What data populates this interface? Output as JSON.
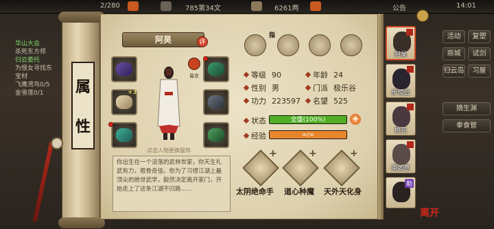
{
  "topbar": {
    "counter": "2/280",
    "rank": "785第34文",
    "money": "6261两",
    "notice": "公告",
    "time": "14:01"
  },
  "quests": [
    {
      "title": "华山大会",
      "text": "杀死东方师"
    },
    {
      "title": "归云委托",
      "text": "为恨女寻找东"
    },
    {
      "title": "",
      "text": "宝材"
    },
    {
      "title": "",
      "text": "飞鹰鸢鸟0/5"
    },
    {
      "title": "",
      "text": "金雪莲0/1"
    }
  ],
  "right_menu": [
    "活动",
    "复塑",
    "商城",
    "试剑",
    "归云岛",
    "习屋",
    "摘生渊",
    "拳食管"
  ],
  "scroll": {
    "title_top": "属",
    "title_bottom": "性"
  },
  "character": {
    "name": "阿昊",
    "badge": "评",
    "swap_label": "易衣",
    "change_hint": "点击人物更换服饰",
    "equip_plus": "+3"
  },
  "icons": {
    "zhi_label": "指"
  },
  "stats": {
    "level_label": "等级",
    "level": "90",
    "age_label": "年龄",
    "age": "24",
    "gender_label": "性别",
    "gender": "男",
    "sect_label": "门派",
    "sect": "极乐谷",
    "power_label": "功力",
    "power": "223597",
    "fame_label": "名望",
    "fame": "525",
    "state_label": "状态",
    "state_text": "全盛(100%)",
    "state_fill": 1.0,
    "exp_label": "经验",
    "exp_text": "∞/∞",
    "exp_fill": 1.0
  },
  "description": "你出生在一个没落的武林世家，你天生礼武有力，根骨奇佳。你为了习得江湖上最顶尖的绝世武学，毅然决定离开家门，开始走上了这条江湖不归路……",
  "skills": [
    {
      "name": "太阴绝命手",
      "plus": "+"
    },
    {
      "name": "道心种魔",
      "plus": "+"
    },
    {
      "name": "天外天化身",
      "plus": "+"
    }
  ],
  "party": [
    {
      "name": "阿昊",
      "tag": "战"
    },
    {
      "name": "步惊云",
      "tag": "战"
    },
    {
      "name": "桃花",
      "tag": "战"
    },
    {
      "name": "南如意",
      "tag": "战"
    },
    {
      "name": "",
      "tag": "助"
    }
  ],
  "leave_label": "离开",
  "colors": {
    "state_bar": "#4fae24",
    "exp_bar": "#e7862c",
    "accent_red": "#c8441f"
  }
}
